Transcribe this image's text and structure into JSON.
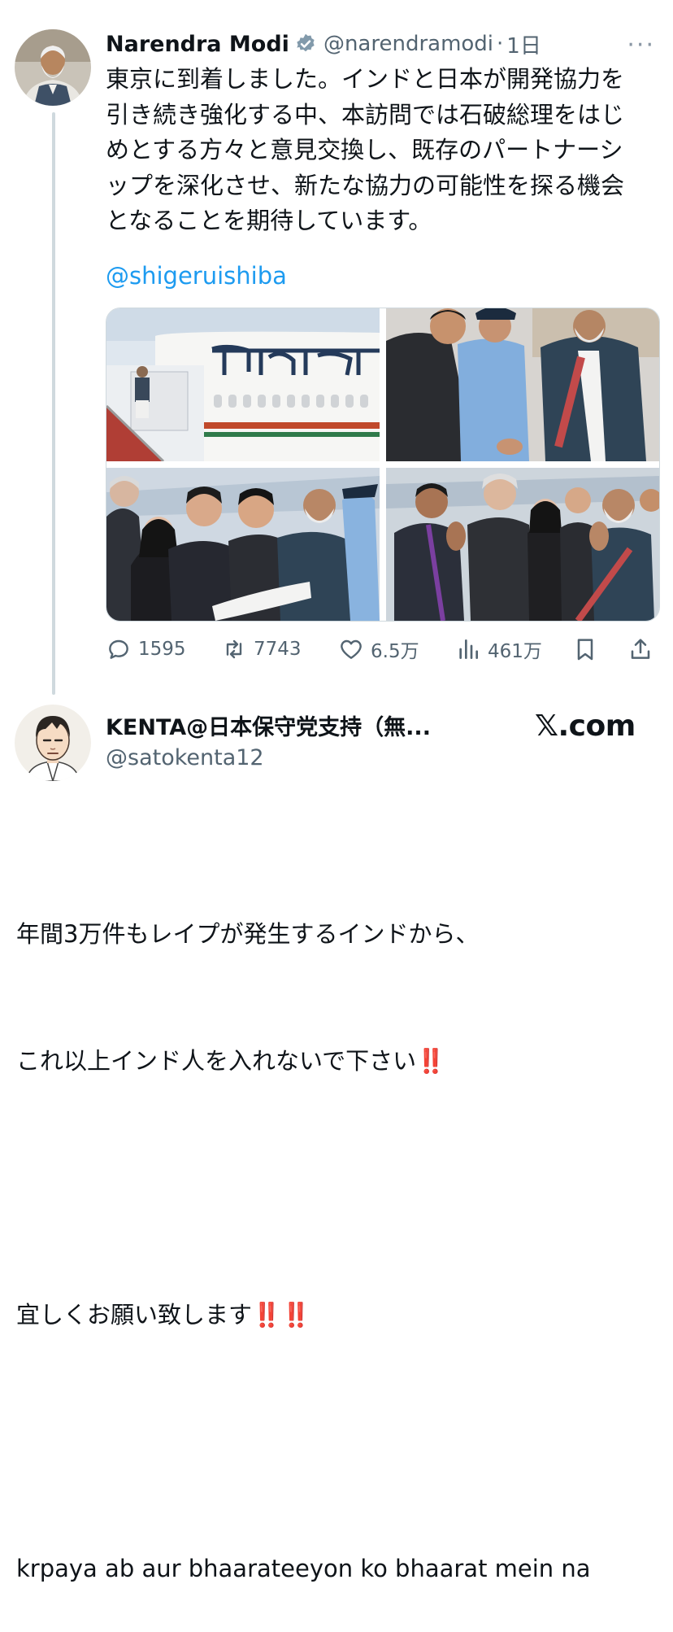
{
  "tweet": {
    "author_name": "Narendra Modi",
    "handle": "@narendramodi",
    "separator": "·",
    "time": "1日",
    "more_label": "···",
    "text": "東京に到着しました。インドと日本が開発協力を\n引き続き強化する中、本訪問では石破総理をはじ\nめとする方々と意見交換し、既存のパートナーシ\nップを深化させ、新たな協力の可能性を探る機会\nとなることを期待しています。",
    "mention": "@shigeruishiba",
    "actions": {
      "replies": "1595",
      "retweets": "7743",
      "likes": "6.5万",
      "views": "461万"
    }
  },
  "reply": {
    "author_name": "KENTA@日本保守党支持（無...",
    "handle": "@satokenta12",
    "watermark": "𝕏.com",
    "line1": "年間3万件もレイプが発生するインドから、",
    "line2_text": "これ以上インド人を入れないで下さい",
    "line2_emoji": "‼️",
    "line3_text": "宜しくお願い致します",
    "line3_emoji": "‼️‼️",
    "line4": "krpaya ab aur bhaarateeyon ko bhaarat mein na"
  },
  "colors": {
    "accent": "#1d9bf0",
    "text": "#0f1419",
    "muted": "#536471",
    "verified": "#829aab",
    "emphasis": "#e0245e"
  },
  "icons": [
    "reply-icon",
    "retweet-icon",
    "like-icon",
    "views-icon",
    "bookmark-icon",
    "share-icon",
    "verified-badge-icon"
  ]
}
